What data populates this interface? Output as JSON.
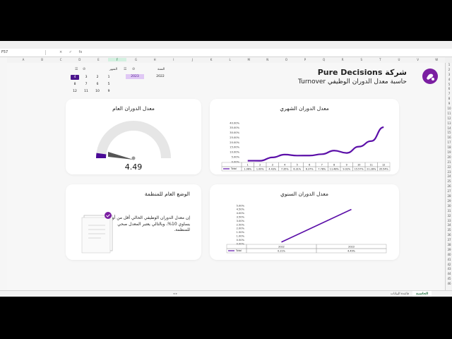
{
  "app": {
    "name_box": "F57",
    "formula_icons": [
      "×",
      "✓",
      "fx"
    ]
  },
  "columns": [
    "A",
    "B",
    "C",
    "D",
    "E",
    "F",
    "G",
    "H",
    "I",
    "J",
    "K",
    "L",
    "M",
    "N",
    "O",
    "P",
    "Q",
    "R",
    "S",
    "T",
    "U",
    "V",
    "W",
    "X"
  ],
  "selected_column": "F",
  "rows": [
    "1",
    "2",
    "3",
    "4",
    "5",
    "6",
    "7",
    "8",
    "9",
    "10",
    "11",
    "12",
    "13",
    "14",
    "15",
    "16",
    "17",
    "18",
    "19",
    "20",
    "21",
    "22",
    "23",
    "24",
    "25",
    "26",
    "27",
    "28",
    "29",
    "30",
    "31",
    "32",
    "33",
    "34",
    "35",
    "36",
    "37",
    "38",
    "39",
    "40",
    "41",
    "42",
    "43",
    "44",
    "45",
    "46"
  ],
  "header": {
    "company": "شركة Pure Decisions",
    "subtitle": "حاسبة معدل الدوران الوظيفي Turnover",
    "brand_color": "#7b1fa2"
  },
  "filters": {
    "month_label": "الشهر",
    "year_label": "السنة",
    "months": [
      "1",
      "2",
      "3",
      "4",
      "5",
      "6",
      "7",
      "8",
      "9",
      "10",
      "11",
      "12"
    ],
    "selected_month": "4",
    "years": [
      "2022",
      "2023"
    ],
    "selected_year": "2023"
  },
  "cards": {
    "general_rate_title": "معدل الدوران العام",
    "gauge_value": "4.49",
    "gauge_fraction": 0.449,
    "monthly_title": "معدل الدوران الشهري",
    "status_title": "الوضع العام للمنظمة",
    "status_text": "إن معدل الدوران الوظيفي الحالي أقل من أو يساوي 10%، وبالتالي يعتبر المعدل صحي للمنظمة.",
    "yearly_title": "معدل الدوران السنوي"
  },
  "chart_data": [
    {
      "type": "line",
      "categories": [
        "1",
        "2",
        "3",
        "4",
        "5",
        "6",
        "7",
        "8",
        "9",
        "10",
        "11",
        "12"
      ],
      "series": [
        {
          "name": "Total",
          "values": [
            1.06,
            1.0,
            4.43,
            7.35,
            6.31,
            6.37,
            7.78,
            11.48,
            9.02,
            15.57,
            21.28,
            35.54
          ]
        }
      ],
      "value_labels": [
        "1.06%",
        "1.00%",
        "4.43%",
        "7.35%",
        "6.31%",
        "6.37%",
        "7.78%",
        "11.48%",
        "9.02%",
        "15.57%",
        "21.28%",
        "35.54%"
      ],
      "yticks": [
        "0.00%",
        "5.00%",
        "10.00%",
        "15.00%",
        "20.00%",
        "25.00%",
        "30.00%",
        "35.00%",
        "40.00%"
      ],
      "ylim": [
        0,
        40
      ],
      "color": "#5b0fa8"
    },
    {
      "type": "line",
      "categories": [
        "2022",
        "2023"
      ],
      "series": [
        {
          "name": "Total",
          "values": [
            0.21,
            4.49
          ]
        }
      ],
      "value_labels": [
        "0.21%",
        "4.49%"
      ],
      "yticks": [
        "0.00%",
        "0.50%",
        "1.00%",
        "1.50%",
        "2.00%",
        "2.50%",
        "3.00%",
        "3.50%",
        "4.00%",
        "4.50%",
        "5.00%"
      ],
      "ylim": [
        0,
        5
      ],
      "color": "#5b0fa8"
    }
  ],
  "sheets": {
    "tabs": [
      "الحاسبة",
      "قاعدة البيانات"
    ],
    "active": "الحاسبة"
  }
}
